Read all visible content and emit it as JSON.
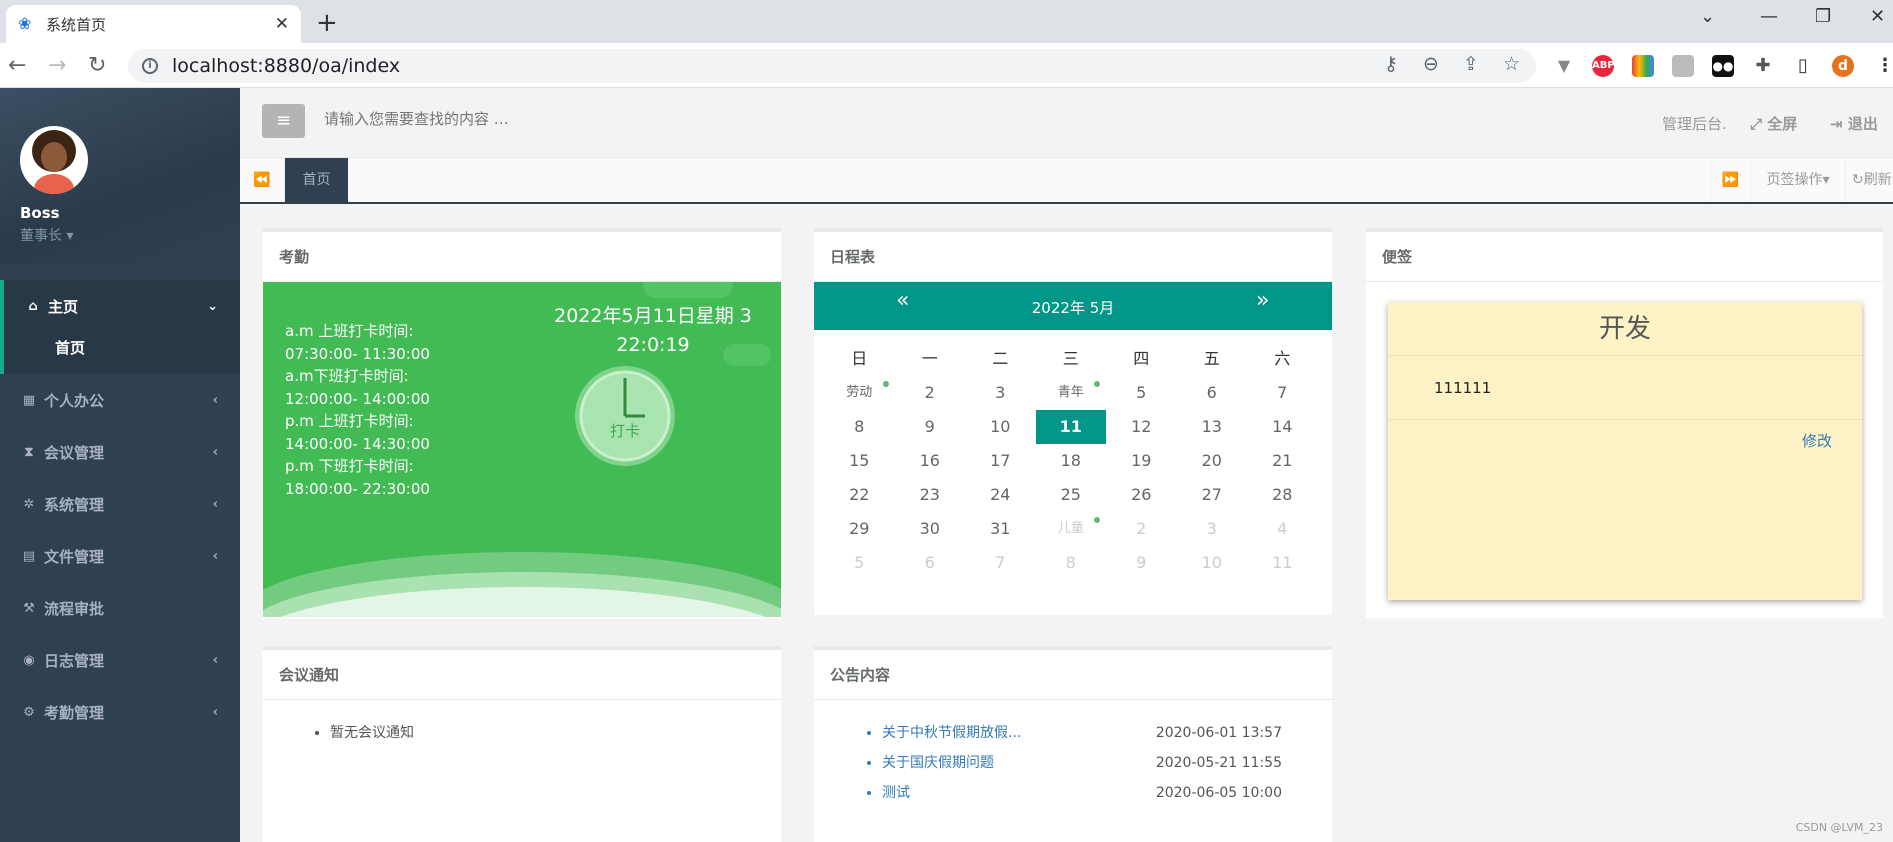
{
  "browser": {
    "tab_title": "系统首页",
    "url": "localhost:8880/oa/index",
    "ext_abp": "ABP",
    "profile_initial": "d"
  },
  "sidebar": {
    "user_name": "Boss",
    "user_role": "董事长",
    "items": [
      {
        "label": "主页",
        "icon": "home-icon"
      },
      {
        "label": "个人办公",
        "icon": "calendar-icon"
      },
      {
        "label": "会议管理",
        "icon": "hourglass-icon"
      },
      {
        "label": "系统管理",
        "icon": "gear-icon"
      },
      {
        "label": "文件管理",
        "icon": "file-icon"
      },
      {
        "label": "流程审批",
        "icon": "gavel-icon"
      },
      {
        "label": "日志管理",
        "icon": "eye-icon"
      },
      {
        "label": "考勤管理",
        "icon": "gears-icon"
      }
    ],
    "sub_home": "首页"
  },
  "header": {
    "search_placeholder": "请输入您需要查找的内容 …",
    "admin_label": "管理后台",
    "fullscreen_label": "全屏",
    "logout_label": "退出"
  },
  "tabs": {
    "active_label": "首页",
    "tab_ops_label": "页签操作",
    "refresh_label": "刷新"
  },
  "attendance": {
    "title": "考勤",
    "lines": [
      "a.m 上班打卡时间:",
      "07:30:00- 11:30:00",
      "a.m下班打卡时间:",
      "12:00:00- 14:00:00",
      "p.m 上班打卡时间:",
      "14:00:00- 14:30:00",
      "p.m 下班打卡时间:",
      "18:00:00- 22:30:00"
    ],
    "date_line": "2022年5月11日星期 3",
    "time_line": "22:0:19",
    "clock_button": "打卡"
  },
  "schedule": {
    "title": "日程表",
    "month_label": "2022年  5月",
    "weekdays": [
      "日",
      "一",
      "二",
      "三",
      "四",
      "五",
      "六"
    ],
    "weeks": [
      [
        "劳动",
        "2",
        "3",
        "青年",
        "5",
        "6",
        "7"
      ],
      [
        "8",
        "9",
        "10",
        "11",
        "12",
        "13",
        "14"
      ],
      [
        "15",
        "16",
        "17",
        "18",
        "19",
        "20",
        "21"
      ],
      [
        "22",
        "23",
        "24",
        "25",
        "26",
        "27",
        "28"
      ],
      [
        "29",
        "30",
        "31",
        "儿童",
        "2",
        "3",
        "4"
      ],
      [
        "5",
        "6",
        "7",
        "8",
        "9",
        "10",
        "11"
      ]
    ]
  },
  "sticky": {
    "title": "便签",
    "note_title": "开发",
    "note_body": "111111",
    "edit_label": "修改"
  },
  "meetings": {
    "title": "会议通知",
    "empty_text": "暂无会议通知"
  },
  "notices": {
    "title": "公告内容",
    "items": [
      {
        "title": "关于中秋节假期放假...",
        "date": "2020-06-01 13:57"
      },
      {
        "title": "关于国庆假期问题",
        "date": "2020-05-21 11:55"
      },
      {
        "title": "测试",
        "date": "2020-06-05 10:00"
      }
    ]
  },
  "watermark": "CSDN @LVM_23",
  "colors": {
    "sidebar": "#2f4050",
    "accent": "#009688",
    "attendance_green": "#42bb55",
    "note": "#fdf3c7"
  }
}
